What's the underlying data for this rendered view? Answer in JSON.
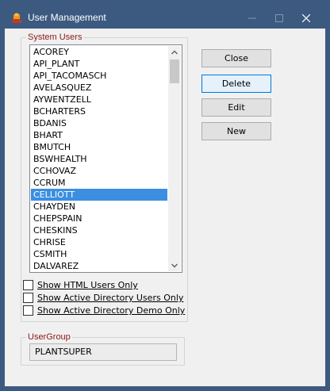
{
  "window": {
    "title": "User Management"
  },
  "system_users": {
    "legend": "System Users",
    "items": [
      "ACOREY",
      "API_PLANT",
      "API_TACOMASCH",
      "AVELASQUEZ",
      "AYWENTZELL",
      "BCHARTERS",
      "BDANIS",
      "BHART",
      "BMUTCH",
      "BSWHEALTH",
      "CCHOVAZ",
      "CCRUM",
      "CELLIOTT",
      "CHAYDEN",
      "CHEPSPAIN",
      "CHESKINS",
      "CHRISE",
      "CSMITH",
      "DALVAREZ"
    ],
    "selected": "CELLIOTT"
  },
  "filters": {
    "html_only": "Show HTML Users Only",
    "ad_only": "Show Active Directory Users Only",
    "ad_demo_only": "Show Active Directory Demo Only"
  },
  "usergroup": {
    "legend": "UserGroup",
    "value": "PLANTSUPER"
  },
  "buttons": {
    "close": "Close",
    "delete": "Delete",
    "edit": "Edit",
    "new": "New"
  },
  "colors": {
    "titlebar": "#3c5a80",
    "selection": "#3b8ee0",
    "legend_text": "#8b1a1a"
  }
}
